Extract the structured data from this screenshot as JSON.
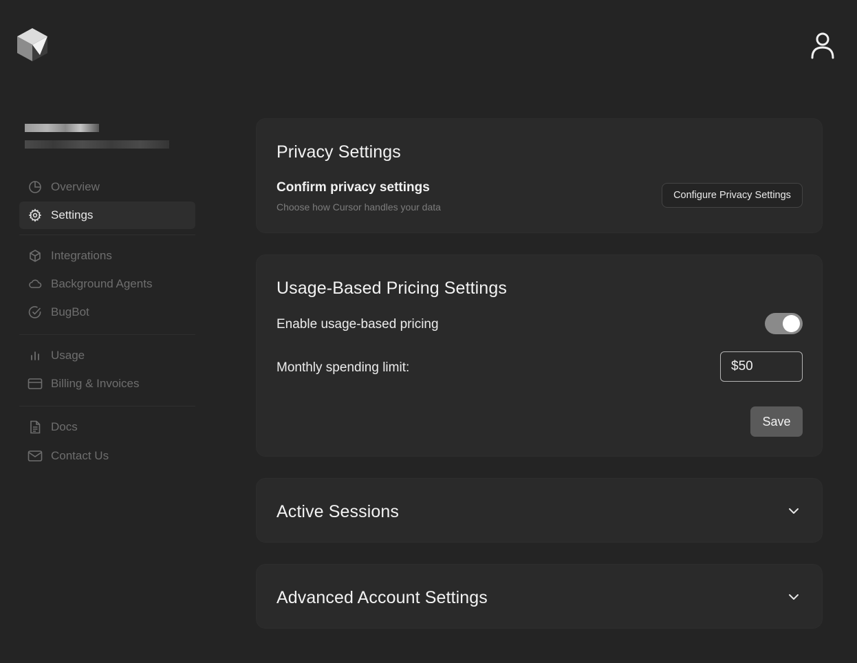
{
  "header": {
    "logo_icon": "cube-logo-icon",
    "account_icon": "user-icon"
  },
  "sidebar": {
    "primary": [
      {
        "label": "Overview",
        "icon": "pie-chart-icon",
        "active": false
      },
      {
        "label": "Settings",
        "icon": "gear-icon",
        "active": true
      }
    ],
    "secondary": [
      {
        "label": "Integrations",
        "icon": "box-icon"
      },
      {
        "label": "Background Agents",
        "icon": "cloud-icon"
      },
      {
        "label": "BugBot",
        "icon": "check-circle-icon"
      }
    ],
    "tertiary": [
      {
        "label": "Usage",
        "icon": "bar-chart-icon"
      },
      {
        "label": "Billing & Invoices",
        "icon": "credit-card-icon"
      }
    ],
    "quaternary": [
      {
        "label": "Docs",
        "icon": "document-icon"
      },
      {
        "label": "Contact Us",
        "icon": "mail-icon"
      }
    ]
  },
  "privacy": {
    "title": "Privacy Settings",
    "subtitle": "Confirm privacy settings",
    "description": "Choose how Cursor handles your data",
    "button_label": "Configure Privacy Settings"
  },
  "usage": {
    "title": "Usage-Based Pricing Settings",
    "enable_label": "Enable usage-based pricing",
    "enabled": true,
    "limit_label": "Monthly spending limit:",
    "limit_value": "$50",
    "save_label": "Save"
  },
  "sessions": {
    "title": "Active Sessions",
    "icon": "chevron-down-icon"
  },
  "advanced": {
    "title": "Advanced Account Settings",
    "icon": "chevron-down-icon"
  },
  "colors": {
    "background": "#242424",
    "card": "#2a2a2a",
    "toggle_on": "#8a8a8a",
    "save_button": "#5a5a5a"
  }
}
